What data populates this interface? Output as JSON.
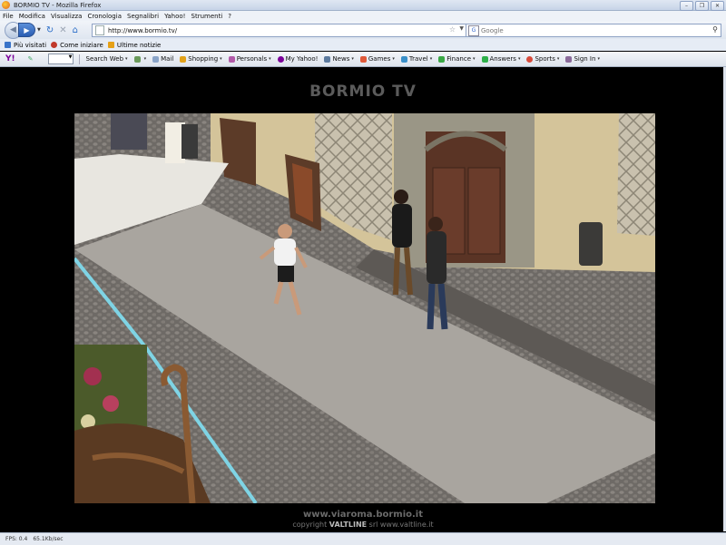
{
  "window": {
    "title": "BORMIO TV - Mozilla Firefox"
  },
  "menu": [
    "File",
    "Modifica",
    "Visualizza",
    "Cronologia",
    "Segnalibri",
    "Yahoo!",
    "Strumenti",
    "?"
  ],
  "nav": {
    "url": "http://www.bormio.tv/",
    "search_placeholder": "Google"
  },
  "bookmarks": [
    {
      "label": "Più visitati",
      "color": "#3a74c9"
    },
    {
      "label": "Come iniziare",
      "color": "#c0392b"
    },
    {
      "label": "Ultime notizie",
      "color": "#e6a117"
    }
  ],
  "yahoo": {
    "logo": "Y!",
    "items": [
      {
        "label": "Search Web",
        "color": "#ffffff"
      },
      {
        "label": "Mail",
        "color": "#8aa4c8"
      },
      {
        "label": "Shopping",
        "color": "#e2a21a"
      },
      {
        "label": "Personals",
        "color": "#b25aa8"
      },
      {
        "label": "My Yahoo!",
        "color": "#7b0099"
      },
      {
        "label": "News",
        "color": "#5c7a9e"
      },
      {
        "label": "Games",
        "color": "#e05a3a"
      },
      {
        "label": "Travel",
        "color": "#3a90c9"
      },
      {
        "label": "Finance",
        "color": "#3aa845"
      },
      {
        "label": "Answers",
        "color": "#2fb04a"
      },
      {
        "label": "Sports",
        "color": "#d84a3a"
      },
      {
        "label": "Sign In",
        "color": "#8a6a9a"
      }
    ]
  },
  "page": {
    "title": "BORMIO TV",
    "footer_site": "www.viaroma.bormio.it",
    "copyright_prefix": "copyright",
    "copyright_brand": "VALTLINE",
    "copyright_suffix": "srl www.valtline.it"
  },
  "status": {
    "fps": "FPS: 0.4",
    "rate": "65.1Kb/sec"
  }
}
